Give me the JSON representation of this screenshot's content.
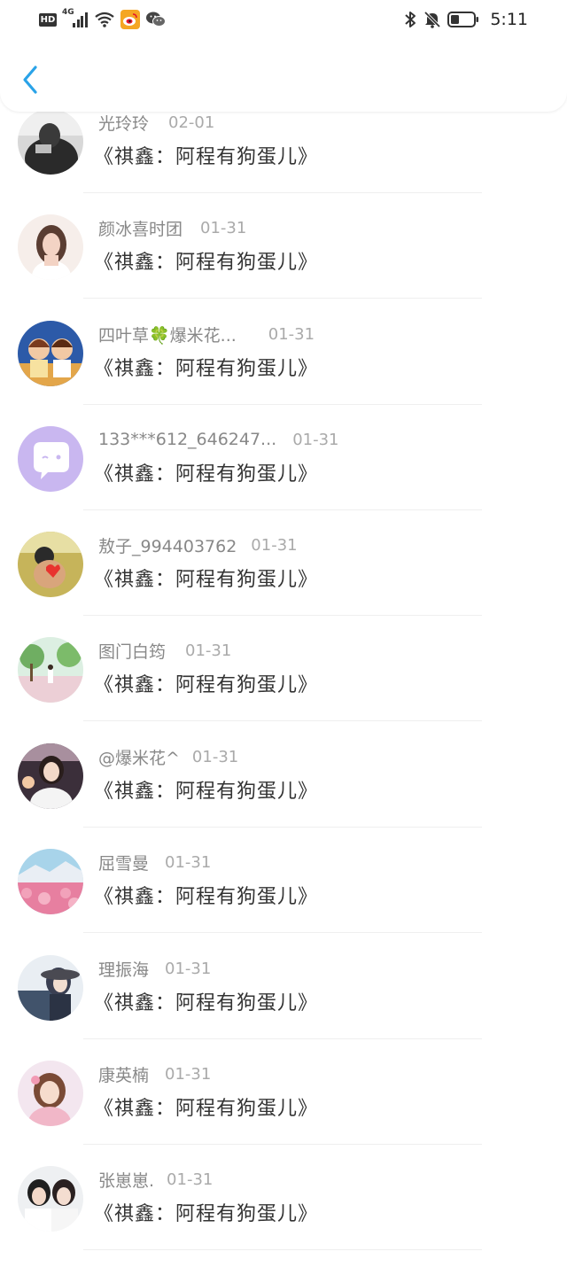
{
  "status_bar": {
    "hd": "HD",
    "network": "4G",
    "time": "5:11",
    "icons": [
      "hd-icon",
      "4g-signal-icon",
      "wifi-icon",
      "weibo-icon",
      "wechat-icon",
      "bluetooth-icon",
      "mute-icon",
      "battery-icon"
    ]
  },
  "nav": {
    "back_icon": "chevron-left-icon",
    "accent": "#2aa3e8"
  },
  "comments": [
    {
      "name": "光玲玲",
      "date": "02-01",
      "text": "《祺鑫：阿程有狗蛋儿》"
    },
    {
      "name": "颜冰喜时团",
      "date": "01-31",
      "text": "《祺鑫：阿程有狗蛋儿》"
    },
    {
      "name": "四叶草🍀爆米花...",
      "date": "01-31",
      "text": "《祺鑫：阿程有狗蛋儿》"
    },
    {
      "name": "133***612_646247...",
      "date": "01-31",
      "text": "《祺鑫：阿程有狗蛋儿》"
    },
    {
      "name": "敖子_994403762",
      "date": "01-31",
      "text": "《祺鑫：阿程有狗蛋儿》"
    },
    {
      "name": "图门白筠",
      "date": "01-31",
      "text": "《祺鑫：阿程有狗蛋儿》"
    },
    {
      "name": "@爆米花^",
      "date": "01-31",
      "text": "《祺鑫：阿程有狗蛋儿》"
    },
    {
      "name": "屈雪曼",
      "date": "01-31",
      "text": "《祺鑫：阿程有狗蛋儿》"
    },
    {
      "name": "理振海",
      "date": "01-31",
      "text": "《祺鑫：阿程有狗蛋儿》"
    },
    {
      "name": "康英楠",
      "date": "01-31",
      "text": "《祺鑫：阿程有狗蛋儿》"
    },
    {
      "name": "张崽崽.",
      "date": "01-31",
      "text": "《祺鑫：阿程有狗蛋儿》"
    }
  ]
}
